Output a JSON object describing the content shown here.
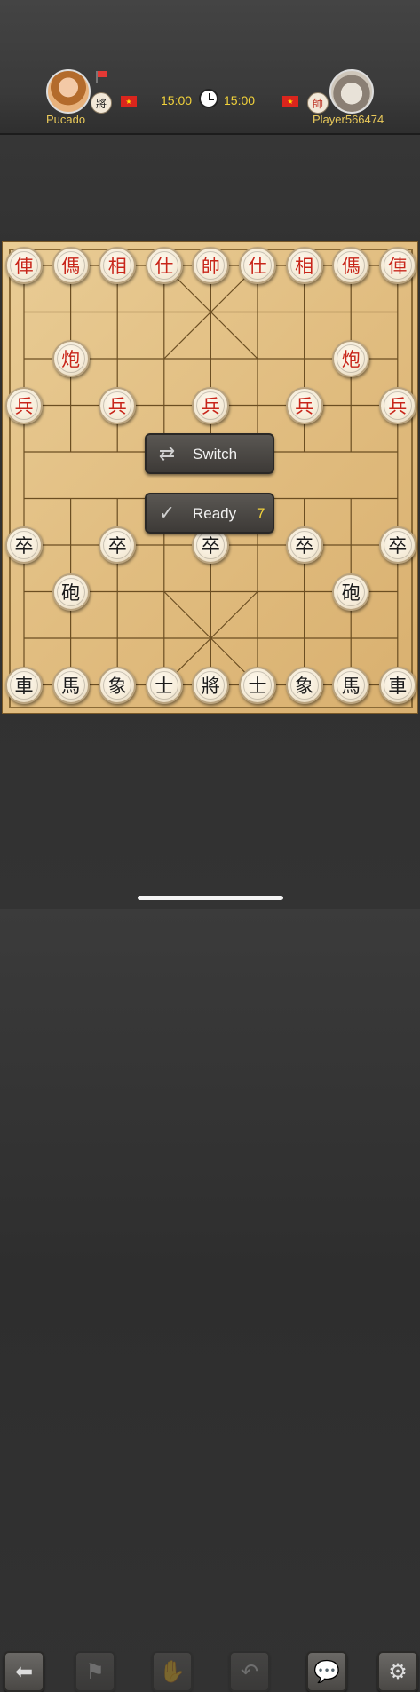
{
  "players": {
    "left": {
      "name": "Pucado",
      "rank_glyph": "將",
      "flag": "★",
      "time": "15:00"
    },
    "right": {
      "name": "Player566474",
      "rank_glyph": "帥",
      "flag": "★",
      "time": "15:00"
    }
  },
  "board": {
    "red_row0": [
      "俥",
      "傌",
      "相",
      "仕",
      "帥",
      "仕",
      "相",
      "傌",
      "俥"
    ],
    "red_cannons": [
      "炮",
      "炮"
    ],
    "red_soldiers": [
      "兵",
      "兵",
      "兵",
      "兵",
      "兵"
    ],
    "black_soldiers": [
      "卒",
      "卒",
      "卒",
      "卒",
      "卒"
    ],
    "black_cannons": [
      "砲",
      "砲"
    ],
    "black_row9": [
      "車",
      "馬",
      "象",
      "士",
      "將",
      "士",
      "象",
      "馬",
      "車"
    ]
  },
  "overlay": {
    "switch_label": "Switch",
    "ready_label": "Ready",
    "ready_count": "7"
  },
  "toolbar": {
    "icons": [
      "back-arrow-icon",
      "resign-icon",
      "handshake-icon",
      "undo-icon",
      "chat-icon",
      "settings-icon"
    ]
  },
  "colors": {
    "red_piece": "#c8261a",
    "black_piece": "#1c1c1c",
    "timer": "#f2d23b",
    "name": "#e9c95a"
  }
}
